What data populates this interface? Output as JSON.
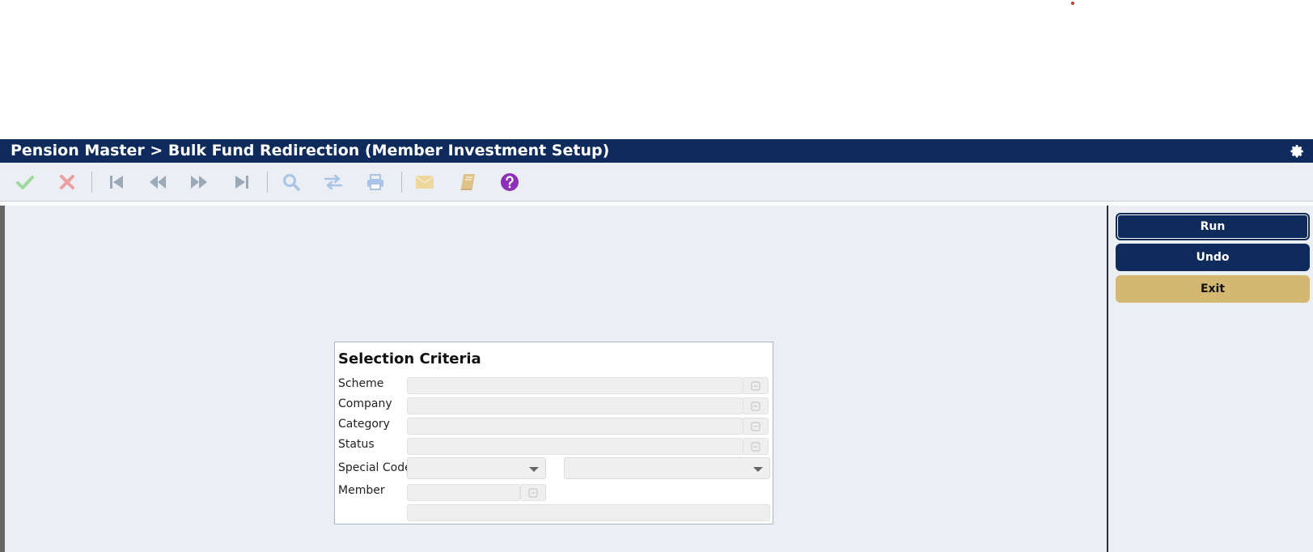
{
  "breadcrumb": "Pension Master > Bulk Fund Redirection (Member Investment Setup)",
  "toolbar": {
    "icons": [
      "check-icon",
      "cross-icon",
      "first-record-icon",
      "previous-record-icon",
      "next-record-icon",
      "last-record-icon",
      "search-icon",
      "exchange-icon",
      "print-icon",
      "mail-icon",
      "book-icon",
      "help-icon"
    ]
  },
  "actions": {
    "run": "Run",
    "undo": "Undo",
    "exit": "Exit"
  },
  "selection": {
    "heading": "Selection Criteria",
    "scheme_label": "Scheme",
    "company_label": "Company",
    "category_label": "Category",
    "status_label": "Status",
    "special_code_label": "Special Code",
    "member_label": "Member",
    "scheme_value": "",
    "company_value": "",
    "category_value": "",
    "status_value": "",
    "special_code_1": "",
    "special_code_2": "",
    "member_value": "",
    "member_name": ""
  },
  "colors": {
    "header": "#0f2b5b",
    "exit_button": "#d4b872",
    "help_icon": "#8e2fb8"
  }
}
